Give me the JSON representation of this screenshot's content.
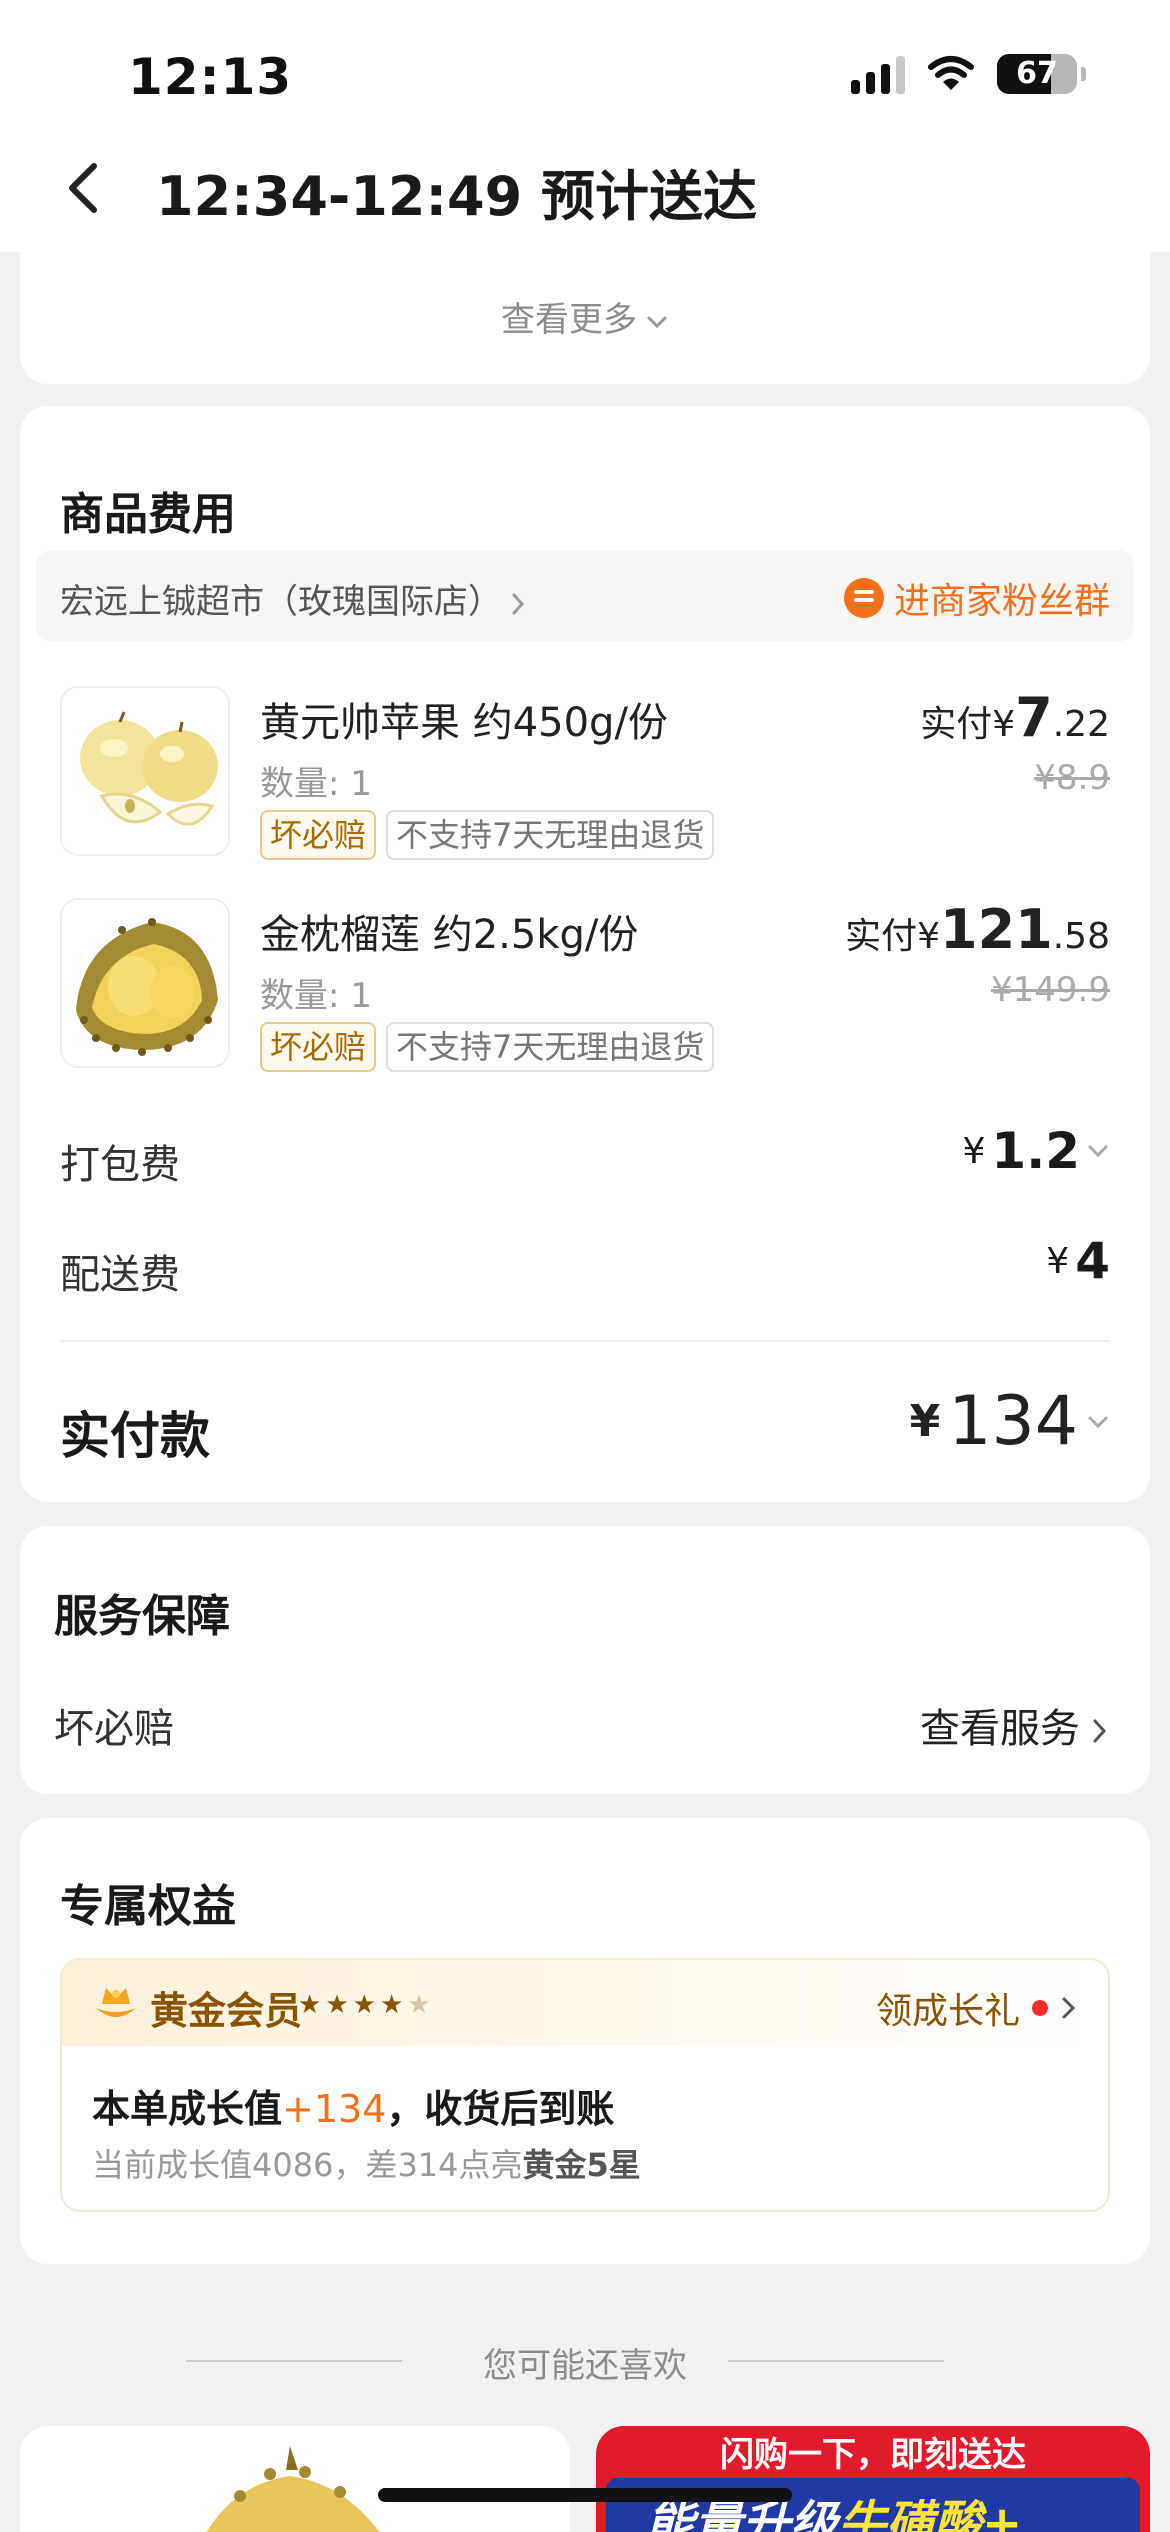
{
  "status_bar": {
    "time": "12:13",
    "battery": "67",
    "battery_level": 0.67
  },
  "nav": {
    "title": "12:34-12:49 预计送达"
  },
  "order_items": {
    "see_more": "查看更多"
  },
  "product_fees": {
    "title": "商品费用",
    "store_name": "宏远上铖超市（玫瑰国际店）",
    "fan_group": "进商家粉丝群",
    "products": [
      {
        "name": "黄元帅苹果 约450g/份",
        "qty": "数量: 1",
        "tag_gold": "坏必赔",
        "tag_gray": "不支持7天无理由退货",
        "paid_prefix": "实付",
        "yen": "¥",
        "paid_int": "7",
        "paid_dec": ".22",
        "original": "¥8.9"
      },
      {
        "name": "金枕榴莲 约2.5kg/份",
        "qty": "数量: 1",
        "tag_gold": "坏必赔",
        "tag_gray": "不支持7天无理由退货",
        "paid_prefix": "实付",
        "yen": "¥",
        "paid_int": "121",
        "paid_dec": ".58",
        "original": "¥149.9"
      }
    ],
    "packing": {
      "label": "打包费",
      "yen": "¥",
      "value": "1.2"
    },
    "delivery": {
      "label": "配送费",
      "yen": "¥",
      "value": "4"
    },
    "total": {
      "label": "实付款",
      "yen": "¥",
      "value": "134"
    }
  },
  "service": {
    "title": "服务保障",
    "label": "坏必赔",
    "link": "查看服务"
  },
  "benefits": {
    "title": "专属权益",
    "level": "黄金会员",
    "stars_filled": 4,
    "stars_total": 5,
    "gift": "领成长礼",
    "main_prefix": "本单成长值",
    "main_value": "+134",
    "main_suffix": "，收货后到账",
    "sub_prefix": "当前成长值4086，差314点亮",
    "sub_bold": "黄金5星"
  },
  "recommend": {
    "title": "您可能还喜欢",
    "promo_top": "闪购一下，即刻送达",
    "promo_text_a": "能量升级",
    "promo_text_b": "牛磺酸+"
  },
  "colors": {
    "accent": "#f5701a",
    "gold": "#8a5300",
    "background": "#f1f1f1"
  }
}
